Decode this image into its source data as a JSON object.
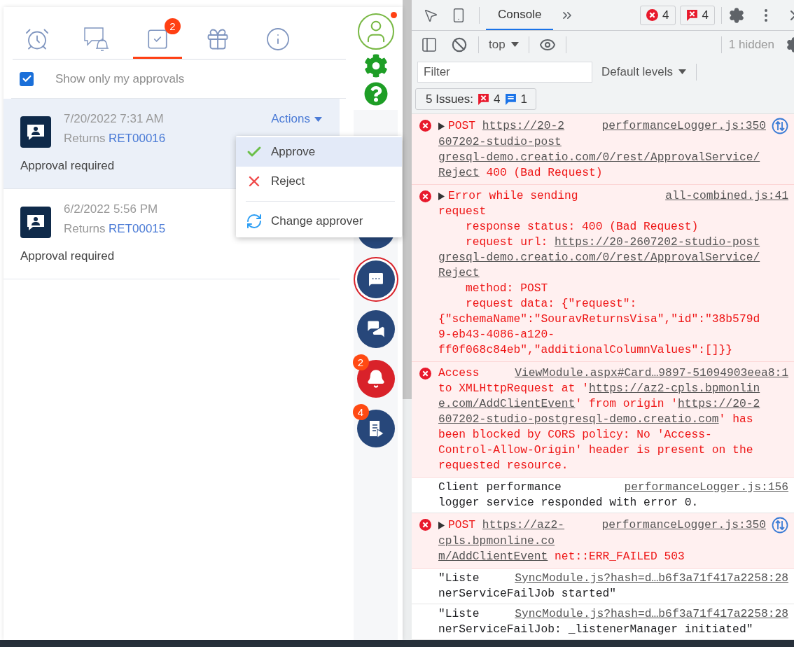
{
  "notifications_panel": {
    "tabs": [
      {
        "kind": "clock",
        "selected": false
      },
      {
        "kind": "chat-bell",
        "selected": false
      },
      {
        "kind": "approval",
        "selected": true,
        "badge": "2"
      },
      {
        "kind": "gift",
        "selected": false
      },
      {
        "kind": "info",
        "selected": false
      }
    ],
    "filter": {
      "label": "Show only my approvals",
      "checked": true
    },
    "items": [
      {
        "selected": true,
        "date": "7/20/2022 7:31 AM",
        "entity": "Returns",
        "record": "RET00016",
        "status": "Approval required",
        "actions": "Actions"
      },
      {
        "selected": false,
        "date": "6/2/2022 5:56 PM",
        "entity": "Returns",
        "record": "RET00015",
        "status": "Approval required"
      }
    ],
    "actions_menu": [
      {
        "kind": "approve",
        "label": "Approve",
        "selected": true
      },
      {
        "kind": "reject",
        "label": "Reject",
        "selected": false
      },
      {
        "kind": "change",
        "label": "Change approver",
        "selected": false
      }
    ]
  },
  "rail": {
    "profile": {
      "notification": true
    },
    "buttons": [
      {
        "kind": "hidden",
        "active": false
      },
      {
        "kind": "chat",
        "active": true
      },
      {
        "kind": "chats",
        "active": false
      },
      {
        "kind": "bell",
        "active": false,
        "badge": "2"
      },
      {
        "kind": "feed",
        "active": false,
        "badge": "4"
      }
    ]
  },
  "devtools": {
    "tabs": [
      {
        "label": "Console",
        "selected": true
      }
    ],
    "error_count": "4",
    "issue_count": "4",
    "context": "top",
    "hidden": "1 hidden",
    "filter": {
      "placeholder": "Filter"
    },
    "levels": "Default levels",
    "issues": {
      "label": "5 Issues:",
      "errors": "4",
      "info": "1"
    },
    "messages": [
      {
        "kind": "error",
        "expandable": true,
        "network": true,
        "source": "performanceLogger.js:350",
        "lines": [
          {
            "segments": [
              {
                "kind": "text",
                "text": "POST "
              },
              {
                "kind": "link",
                "text": "https://20-2"
              }
            ]
          },
          {
            "segments": [
              {
                "kind": "link",
                "text": "607202-studio-post"
              }
            ]
          },
          {
            "segments": [
              {
                "kind": "link",
                "text": "gresql-demo.creatio.com/0/rest/ApprovalService/"
              }
            ]
          },
          {
            "segments": [
              {
                "kind": "link",
                "text": "Reject"
              },
              {
                "kind": "text",
                "text": " 400 (Bad Request)"
              }
            ]
          }
        ]
      },
      {
        "kind": "error",
        "expandable": true,
        "network": false,
        "source": "all-combined.js:41",
        "lines": [
          {
            "segments": [
              {
                "kind": "text",
                "text": "Error while sending"
              }
            ]
          },
          {
            "segments": [
              {
                "kind": "text",
                "text": "request"
              }
            ]
          },
          {
            "indent": true,
            "segments": [
              {
                "kind": "text",
                "text": "response status: 400 (Bad Request)"
              }
            ]
          },
          {
            "indent": true,
            "segments": [
              {
                "kind": "text",
                "text": "request url: "
              },
              {
                "kind": "link",
                "text": "https://20-2607202-studio-post"
              }
            ]
          },
          {
            "segments": [
              {
                "kind": "link",
                "text": "gresql-demo.creatio.com/0/rest/ApprovalService/"
              }
            ]
          },
          {
            "segments": [
              {
                "kind": "link",
                "text": "Reject"
              }
            ]
          },
          {
            "indent": true,
            "segments": [
              {
                "kind": "text",
                "text": "method: POST"
              }
            ]
          },
          {
            "indent": true,
            "segments": [
              {
                "kind": "text",
                "text": "request data: {\"request\":"
              }
            ]
          },
          {
            "segments": [
              {
                "kind": "text",
                "text": "{\"schemaName\":\"SouravReturnsVisa\",\"id\":\"38b579d"
              }
            ]
          },
          {
            "segments": [
              {
                "kind": "text",
                "text": "9-eb43-4086-a120-"
              }
            ]
          },
          {
            "segments": [
              {
                "kind": "text",
                "text": "ff0f068c84eb\",\"additionalColumnValues\":[]}}"
              }
            ]
          }
        ]
      },
      {
        "kind": "error",
        "expandable": false,
        "network": false,
        "source": "ViewModule.aspx#Card…9897-51094903eea8:1",
        "lines": [
          {
            "segments": [
              {
                "kind": "text",
                "text": "Access"
              }
            ]
          },
          {
            "segments": [
              {
                "kind": "text",
                "text": "to XMLHttpRequest at '"
              },
              {
                "kind": "link",
                "text": "https://az2-cpls.bpmonlin"
              }
            ]
          },
          {
            "segments": [
              {
                "kind": "link",
                "text": "e.com/AddClientEvent"
              },
              {
                "kind": "text",
                "text": "' from origin '"
              },
              {
                "kind": "link",
                "text": "https://20-2"
              }
            ]
          },
          {
            "segments": [
              {
                "kind": "link",
                "text": "607202-studio-postgresql-demo.creatio.com"
              },
              {
                "kind": "text",
                "text": "' has"
              }
            ]
          },
          {
            "segments": [
              {
                "kind": "text",
                "text": "been blocked by CORS policy: No 'Access-"
              }
            ]
          },
          {
            "segments": [
              {
                "kind": "text",
                "text": "Control-Allow-Origin' header is present on the"
              }
            ]
          },
          {
            "segments": [
              {
                "kind": "text",
                "text": "requested resource."
              }
            ]
          }
        ]
      },
      {
        "kind": "info",
        "expandable": false,
        "network": false,
        "source": "performanceLogger.js:156",
        "lines": [
          {
            "segments": [
              {
                "kind": "text",
                "text": "Client performance"
              }
            ]
          },
          {
            "segments": [
              {
                "kind": "text",
                "text": "logger service responded with error 0."
              }
            ]
          }
        ]
      },
      {
        "kind": "error",
        "expandable": true,
        "network": true,
        "source": "performanceLogger.js:350",
        "lines": [
          {
            "segments": [
              {
                "kind": "text",
                "text": "POST "
              },
              {
                "kind": "link",
                "text": "https://az2-"
              }
            ]
          },
          {
            "segments": [
              {
                "kind": "link",
                "text": "cpls.bpmonline.co"
              }
            ]
          },
          {
            "segments": [
              {
                "kind": "link",
                "text": "m/AddClientEvent"
              },
              {
                "kind": "text",
                "text": " net::ERR_FAILED 503"
              }
            ]
          }
        ]
      },
      {
        "kind": "info",
        "expandable": false,
        "network": false,
        "source": "SyncModule.js?hash=d…b6f3a71f417a2258:28",
        "lines": [
          {
            "segments": [
              {
                "kind": "text",
                "text": "\"Liste"
              }
            ]
          },
          {
            "segments": [
              {
                "kind": "text",
                "text": "nerServiceFailJob started\""
              }
            ]
          }
        ]
      },
      {
        "kind": "info",
        "expandable": false,
        "network": false,
        "source": "SyncModule.js?hash=d…b6f3a71f417a2258:28",
        "lines": [
          {
            "segments": [
              {
                "kind": "text",
                "text": "\"Liste"
              }
            ]
          },
          {
            "segments": [
              {
                "kind": "text",
                "text": "nerServiceFailJob: _listenerManager initiated\""
              }
            ]
          }
        ]
      }
    ]
  }
}
